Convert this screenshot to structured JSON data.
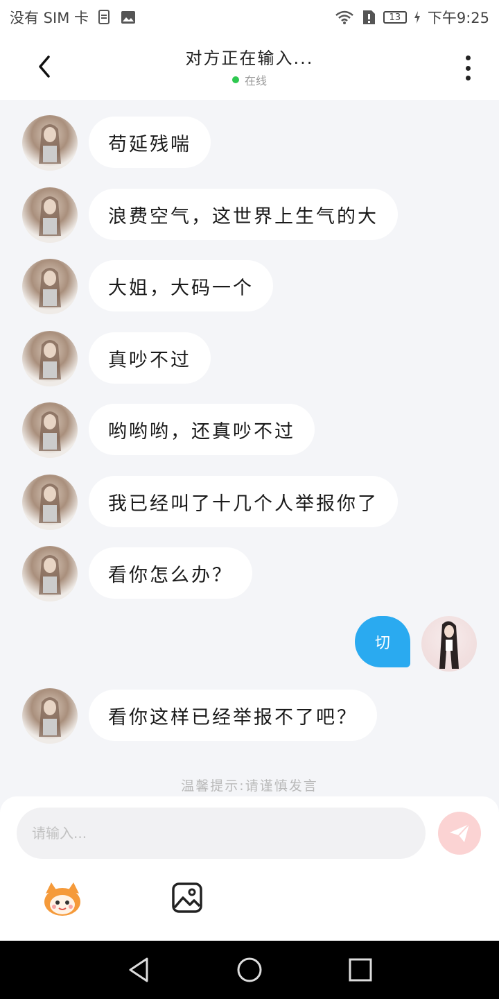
{
  "status_bar": {
    "carrier": "没有 SIM 卡",
    "battery": "13",
    "time": "下午9:25"
  },
  "header": {
    "title": "对方正在输入...",
    "status": "在线"
  },
  "messages": [
    {
      "from": "other",
      "text": "苟延残喘"
    },
    {
      "from": "other",
      "text": "浪费空气，这世界上生气的大"
    },
    {
      "from": "other",
      "text": "大姐，大码一个"
    },
    {
      "from": "other",
      "text": "真吵不过"
    },
    {
      "from": "other",
      "text": "哟哟哟，还真吵不过"
    },
    {
      "from": "other",
      "text": "我已经叫了十几个人举报你了"
    },
    {
      "from": "other",
      "text": "看你怎么办？"
    },
    {
      "from": "me",
      "text": "切"
    },
    {
      "from": "other",
      "text": "看你这样已经举报不了吧？"
    }
  ],
  "hint": "温馨提示:请谨慎发言",
  "input": {
    "placeholder": "请输入..."
  },
  "colors": {
    "accent_blue": "#2aaaf0",
    "online_green": "#2ec850",
    "send_disabled": "#fbd3d3"
  },
  "icons": {
    "back": "chevron-left-icon",
    "more": "more-vertical-icon",
    "send": "paper-plane-icon",
    "emoji": "emoji-mascot-icon",
    "image": "image-icon"
  }
}
